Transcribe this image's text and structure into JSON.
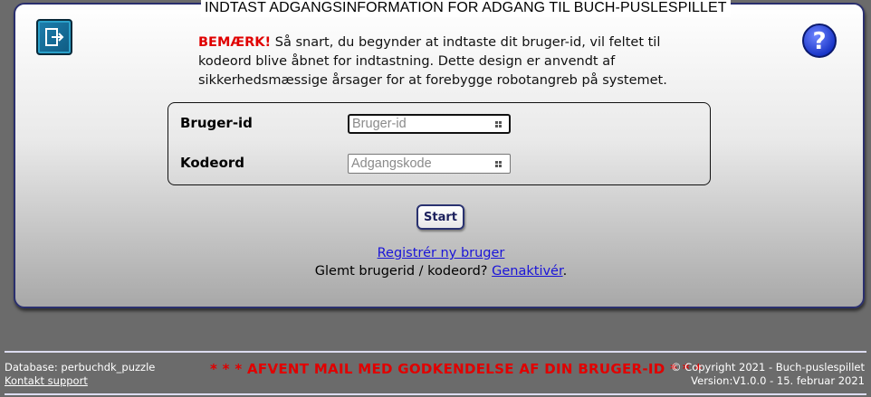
{
  "panel": {
    "title": "INDTAST ADGANGSINFORMATION FOR ADGANG TIL BUCH-PUSLESPILLET",
    "exit_icon": "exit-icon",
    "help_icon": "help-icon"
  },
  "notice": {
    "warning_label": "BEMÆRK!",
    "text": " Så snart, du begynder at indtaste dit bruger-id, vil feltet til kodeord blive åbnet for indtastning. Dette design er anvendt af sikkerhedsmæssige årsager for at forebygge robotangreb på systemet."
  },
  "login": {
    "user_label": "Bruger-id",
    "user_placeholder": "Bruger-id",
    "user_value": "",
    "password_label": "Kodeord",
    "password_placeholder": "Adgangskode",
    "password_value": ""
  },
  "start_button": "Start",
  "links": {
    "register": "Registrér ny bruger",
    "forgot_prefix": "Glemt brugerid / kodeord? ",
    "reactivate": "Genaktivér",
    "forgot_suffix": "."
  },
  "footer": {
    "database": "Database: perbuchdk_puzzle",
    "support": "Kontakt support",
    "status": "* * * AFVENT MAIL MED GODKENDELSE AF DIN BRUGER-ID * * *",
    "copyright": "© Copyright 2021 - Buch-puslespillet",
    "version": "Version:V1.0.0 - 15. februar 2021"
  },
  "colors": {
    "background": "#6b6b6b",
    "panel_border": "#2a2f6e",
    "warning": "#e00000",
    "link": "#1a14d8"
  }
}
